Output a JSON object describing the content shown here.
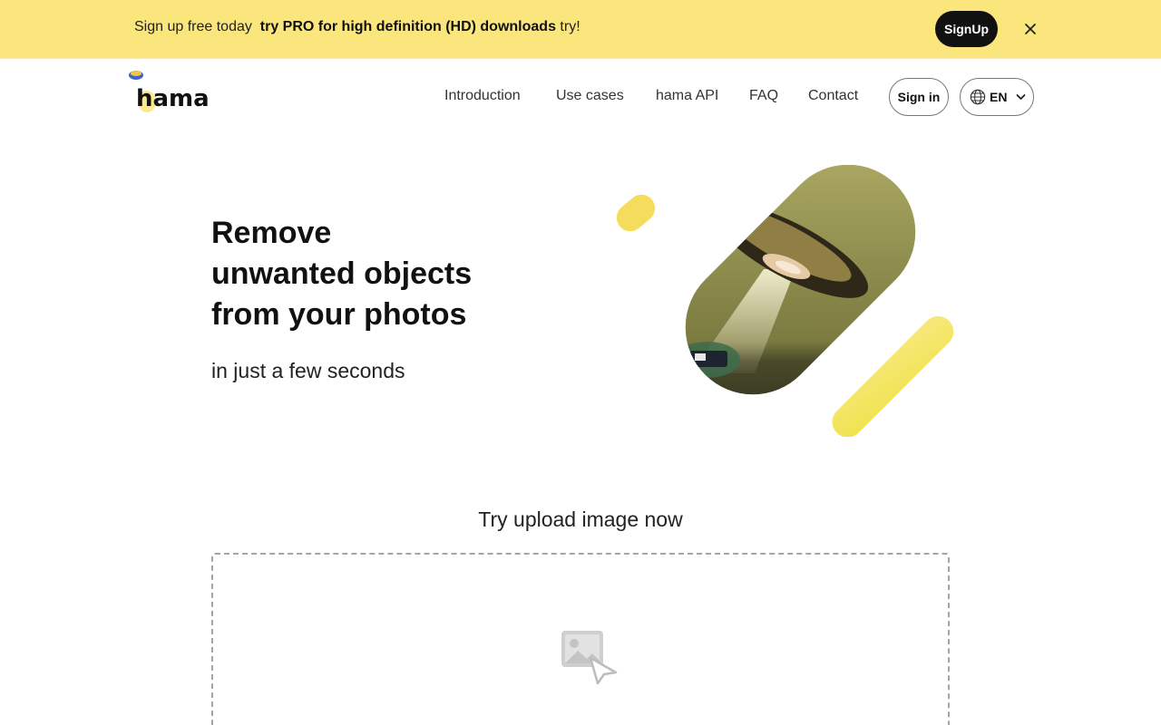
{
  "banner": {
    "text_before": "Sign up free today",
    "text_bold": "try PRO for high definition (HD) downloads",
    "text_after": "try!",
    "signup_label": "SignUp",
    "background": "#fbe57d"
  },
  "header": {
    "logo_text": "hama",
    "nav": [
      "Introduction",
      "Use cases",
      "hama API",
      "FAQ",
      "Contact"
    ],
    "signin_label": "Sign in",
    "language": "EN"
  },
  "hero": {
    "line1": "Remove",
    "line2": "unwanted objects",
    "line3": "from your photos",
    "subtitle": "in just a few seconds",
    "accent": "#fbe57d"
  },
  "upload": {
    "title": "Try upload image now"
  },
  "icons": [
    "close-icon",
    "globe-icon",
    "chevron-down-icon",
    "image-upload-icon"
  ]
}
